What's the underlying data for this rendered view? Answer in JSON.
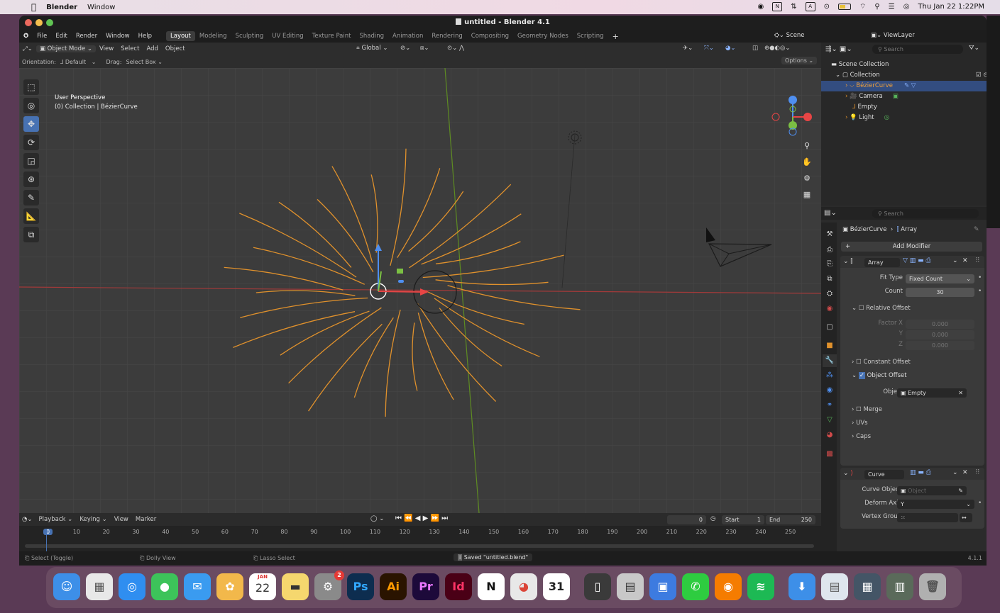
{
  "menubar": {
    "apple": "",
    "app": "Blender",
    "menu": "Window",
    "datetime": "Thu Jan 22  1:22PM"
  },
  "window": {
    "title": "untitled - Blender 4.1"
  },
  "topbar": {
    "menus": [
      "File",
      "Edit",
      "Render",
      "Window",
      "Help"
    ],
    "workspaces": [
      "Layout",
      "Modeling",
      "Sculpting",
      "UV Editing",
      "Texture Paint",
      "Shading",
      "Animation",
      "Rendering",
      "Compositing",
      "Geometry Nodes",
      "Scripting"
    ],
    "active_workspace": "Layout",
    "scene": "Scene",
    "view_layer": "ViewLayer"
  },
  "viewport_header": {
    "mode": "Object Mode",
    "menus": [
      "View",
      "Select",
      "Add",
      "Object"
    ],
    "transform": "Global",
    "orientation_label": "Orientation:",
    "orientation": "Default",
    "drag_label": "Drag:",
    "drag": "Select Box",
    "options": "Options"
  },
  "viewport": {
    "perspective": "User Perspective",
    "context": "(0) Collection | BézierCurve"
  },
  "outliner": {
    "search_placeholder": "Search",
    "root": "Scene Collection",
    "collection": "Collection",
    "items": [
      "BézierCurve",
      "Camera",
      "Empty",
      "Light"
    ]
  },
  "properties": {
    "search_placeholder": "Search",
    "breadcrumb_object": "BézierCurve",
    "breadcrumb_modifier": "Array",
    "add_modifier": "Add Modifier",
    "array": {
      "name": "Array",
      "fit_type_label": "Fit Type",
      "fit_type": "Fixed Count",
      "count_label": "Count",
      "count": "30",
      "relative_offset": "Relative Offset",
      "factor_x_label": "Factor X",
      "factor_x": "0.000",
      "y_label": "Y",
      "y": "0.000",
      "z_label": "Z",
      "z": "0.000",
      "constant_offset": "Constant Offset",
      "object_offset": "Object Offset",
      "object_label": "Object",
      "object": "Empty",
      "merge": "Merge",
      "uvs": "UVs",
      "caps": "Caps"
    },
    "curve": {
      "name": "Curve",
      "curve_object_label": "Curve Object",
      "curve_object_placeholder": "Object",
      "deform_axis_label": "Deform Axis",
      "deform_axis": "Y",
      "vertex_group_label": "Vertex Group"
    }
  },
  "timeline": {
    "menus": [
      "Playback",
      "Keying",
      "View",
      "Marker"
    ],
    "current_frame": "0",
    "start_label": "Start",
    "start": "1",
    "end_label": "End",
    "end": "250",
    "ticks": [
      "0",
      "10",
      "20",
      "30",
      "40",
      "50",
      "60",
      "70",
      "80",
      "90",
      "100",
      "110",
      "120",
      "130",
      "140",
      "150",
      "160",
      "170",
      "180",
      "190",
      "200",
      "210",
      "220",
      "230",
      "240",
      "250"
    ]
  },
  "statusbar": {
    "select": "Select (Toggle)",
    "dolly": "Dolly View",
    "lasso": "Lasso Select",
    "saved": "Saved \"untitled.blend\"",
    "version": "4.1.1"
  },
  "dock": {
    "apps": [
      "Finder",
      "Launchpad",
      "Safari",
      "Messages",
      "Mail",
      "Photos",
      "Calendar",
      "Notes",
      "System Settings",
      "Photoshop",
      "Illustrator",
      "Premiere",
      "InDesign",
      "Notion",
      "Chrome",
      "Calendar 31",
      "Sidecar",
      "Preview",
      "Keynote",
      "WhatsApp",
      "Blender",
      "Spotify",
      "Downloads",
      "Documents",
      "Screens",
      "Recents",
      "Trash"
    ],
    "calendar_month": "JAN",
    "calendar_day": "22",
    "settings_badge": "2"
  },
  "colors": {
    "curve": "#e0912c",
    "accent": "#4772b3",
    "x_axis": "#c93b3b",
    "y_axis": "#6a9a2a"
  }
}
